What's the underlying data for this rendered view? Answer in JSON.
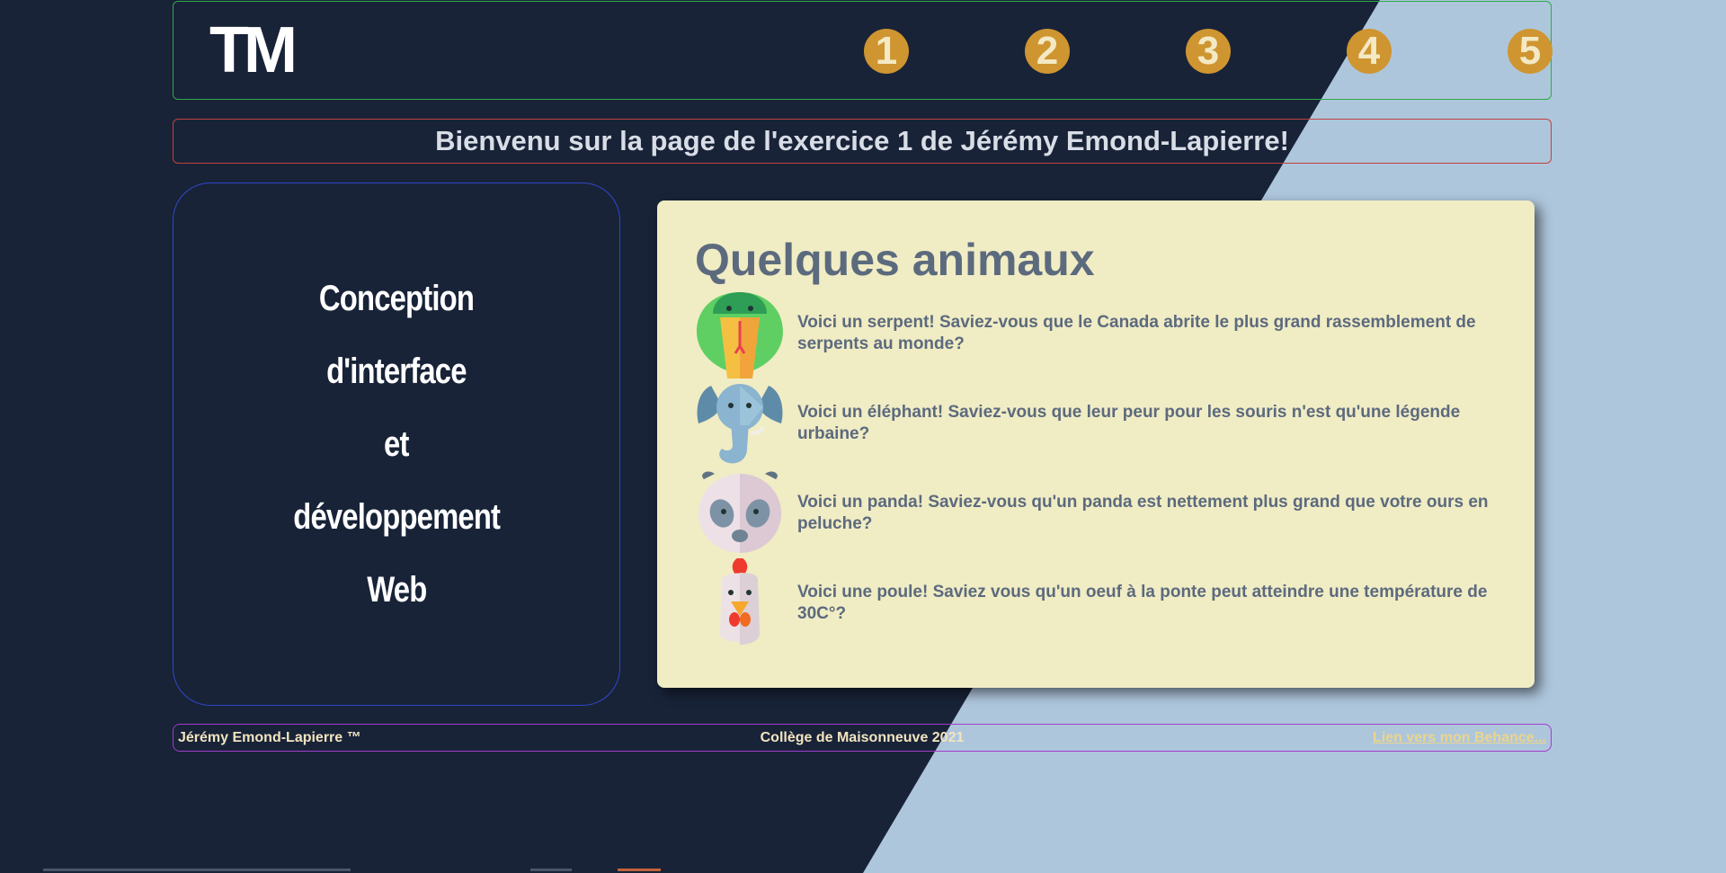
{
  "header": {
    "logo": "TM",
    "nav": [
      "1",
      "2",
      "3",
      "4",
      "5"
    ]
  },
  "welcome": "Bienvenu sur la page de l'exercice 1 de Jérémy Emond-Lapierre!",
  "course": {
    "lines": [
      "Conception",
      "d'interface",
      "et",
      "développement",
      "Web"
    ]
  },
  "card": {
    "title": "Quelques animaux",
    "animals": [
      {
        "icon": "snake-icon",
        "text": "Voici un serpent! Saviez-vous que le Canada abrite le plus grand rassemblement de serpents au monde?"
      },
      {
        "icon": "elephant-icon",
        "text": "Voici un éléphant! Saviez-vous que leur peur pour les souris n'est qu'une légende urbaine?"
      },
      {
        "icon": "panda-icon",
        "text": "Voici un panda! Saviez-vous qu'un panda est nettement plus grand que votre ours en peluche?"
      },
      {
        "icon": "chicken-icon",
        "text": "Voici une poule! Saviez vous qu'un oeuf à la ponte peut atteindre une température de 30C°?"
      }
    ]
  },
  "footer": {
    "left": "Jérémy Emond-Lapierre ™",
    "center": "Collège de Maisonneuve 2021",
    "right": "Lien vers mon Behance..."
  },
  "colors": {
    "dark_bg": "#182338",
    "light_bg": "#aec6dc",
    "nav_circle": "#cf9530",
    "card_bg": "#f0ecc4",
    "header_border": "#2ea84a",
    "welcome_border": "#c2413f",
    "course_border": "#3446c9",
    "footer_border": "#a13ccc"
  }
}
